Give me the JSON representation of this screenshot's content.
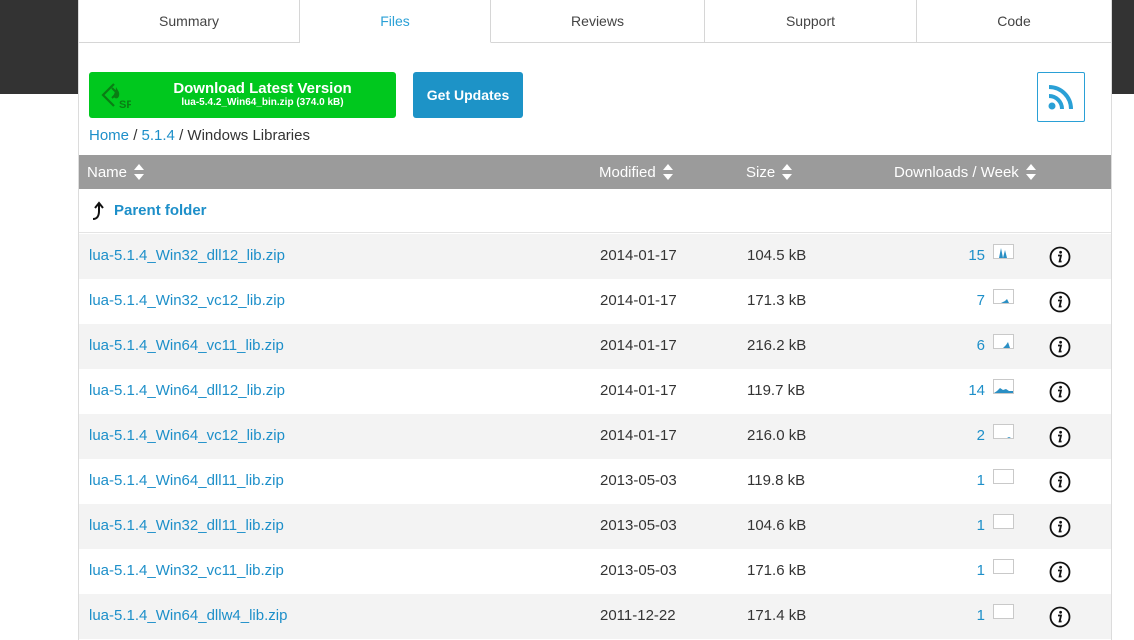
{
  "tabs": [
    {
      "label": "Summary",
      "active": false
    },
    {
      "label": "Files",
      "active": true
    },
    {
      "label": "Reviews",
      "active": false
    },
    {
      "label": "Support",
      "active": false
    },
    {
      "label": "Code",
      "active": false
    }
  ],
  "download": {
    "title": "Download Latest Version",
    "file": "lua-5.4.2_Win64_bin.zip (374.0 kB)",
    "icon": "sourceforge-logo-icon"
  },
  "get_updates_label": "Get Updates",
  "rss_icon": "rss-feed-icon",
  "breadcrumb": {
    "home": "Home",
    "sep1": "/",
    "version": "5.1.4",
    "sep2": "/",
    "current": "Windows Libraries"
  },
  "columns": {
    "name": "Name",
    "modified": "Modified",
    "size": "Size",
    "downloads": "Downloads / Week"
  },
  "parent_folder": "Parent folder",
  "colors": {
    "accent": "#1d8fc9",
    "download_green": "#00c81e",
    "updates_blue": "#1d93c7",
    "header_gray": "#9b9b9b",
    "top_band": "#333333"
  },
  "files": [
    {
      "name": "lua-5.1.4_Win32_dll12_lib.zip",
      "modified": "2014-01-17",
      "size": "104.5 kB",
      "downloads": "15"
    },
    {
      "name": "lua-5.1.4_Win32_vc12_lib.zip",
      "modified": "2014-01-17",
      "size": "171.3 kB",
      "downloads": "7"
    },
    {
      "name": "lua-5.1.4_Win64_vc11_lib.zip",
      "modified": "2014-01-17",
      "size": "216.2 kB",
      "downloads": "6"
    },
    {
      "name": "lua-5.1.4_Win64_dll12_lib.zip",
      "modified": "2014-01-17",
      "size": "119.7 kB",
      "downloads": "14"
    },
    {
      "name": "lua-5.1.4_Win64_vc12_lib.zip",
      "modified": "2014-01-17",
      "size": "216.0 kB",
      "downloads": "2"
    },
    {
      "name": "lua-5.1.4_Win64_dll11_lib.zip",
      "modified": "2013-05-03",
      "size": "119.8 kB",
      "downloads": "1"
    },
    {
      "name": "lua-5.1.4_Win32_dll11_lib.zip",
      "modified": "2013-05-03",
      "size": "104.6 kB",
      "downloads": "1"
    },
    {
      "name": "lua-5.1.4_Win32_vc11_lib.zip",
      "modified": "2013-05-03",
      "size": "171.6 kB",
      "downloads": "1"
    },
    {
      "name": "lua-5.1.4_Win64_dllw4_lib.zip",
      "modified": "2011-12-22",
      "size": "171.4 kB",
      "downloads": "1"
    }
  ]
}
